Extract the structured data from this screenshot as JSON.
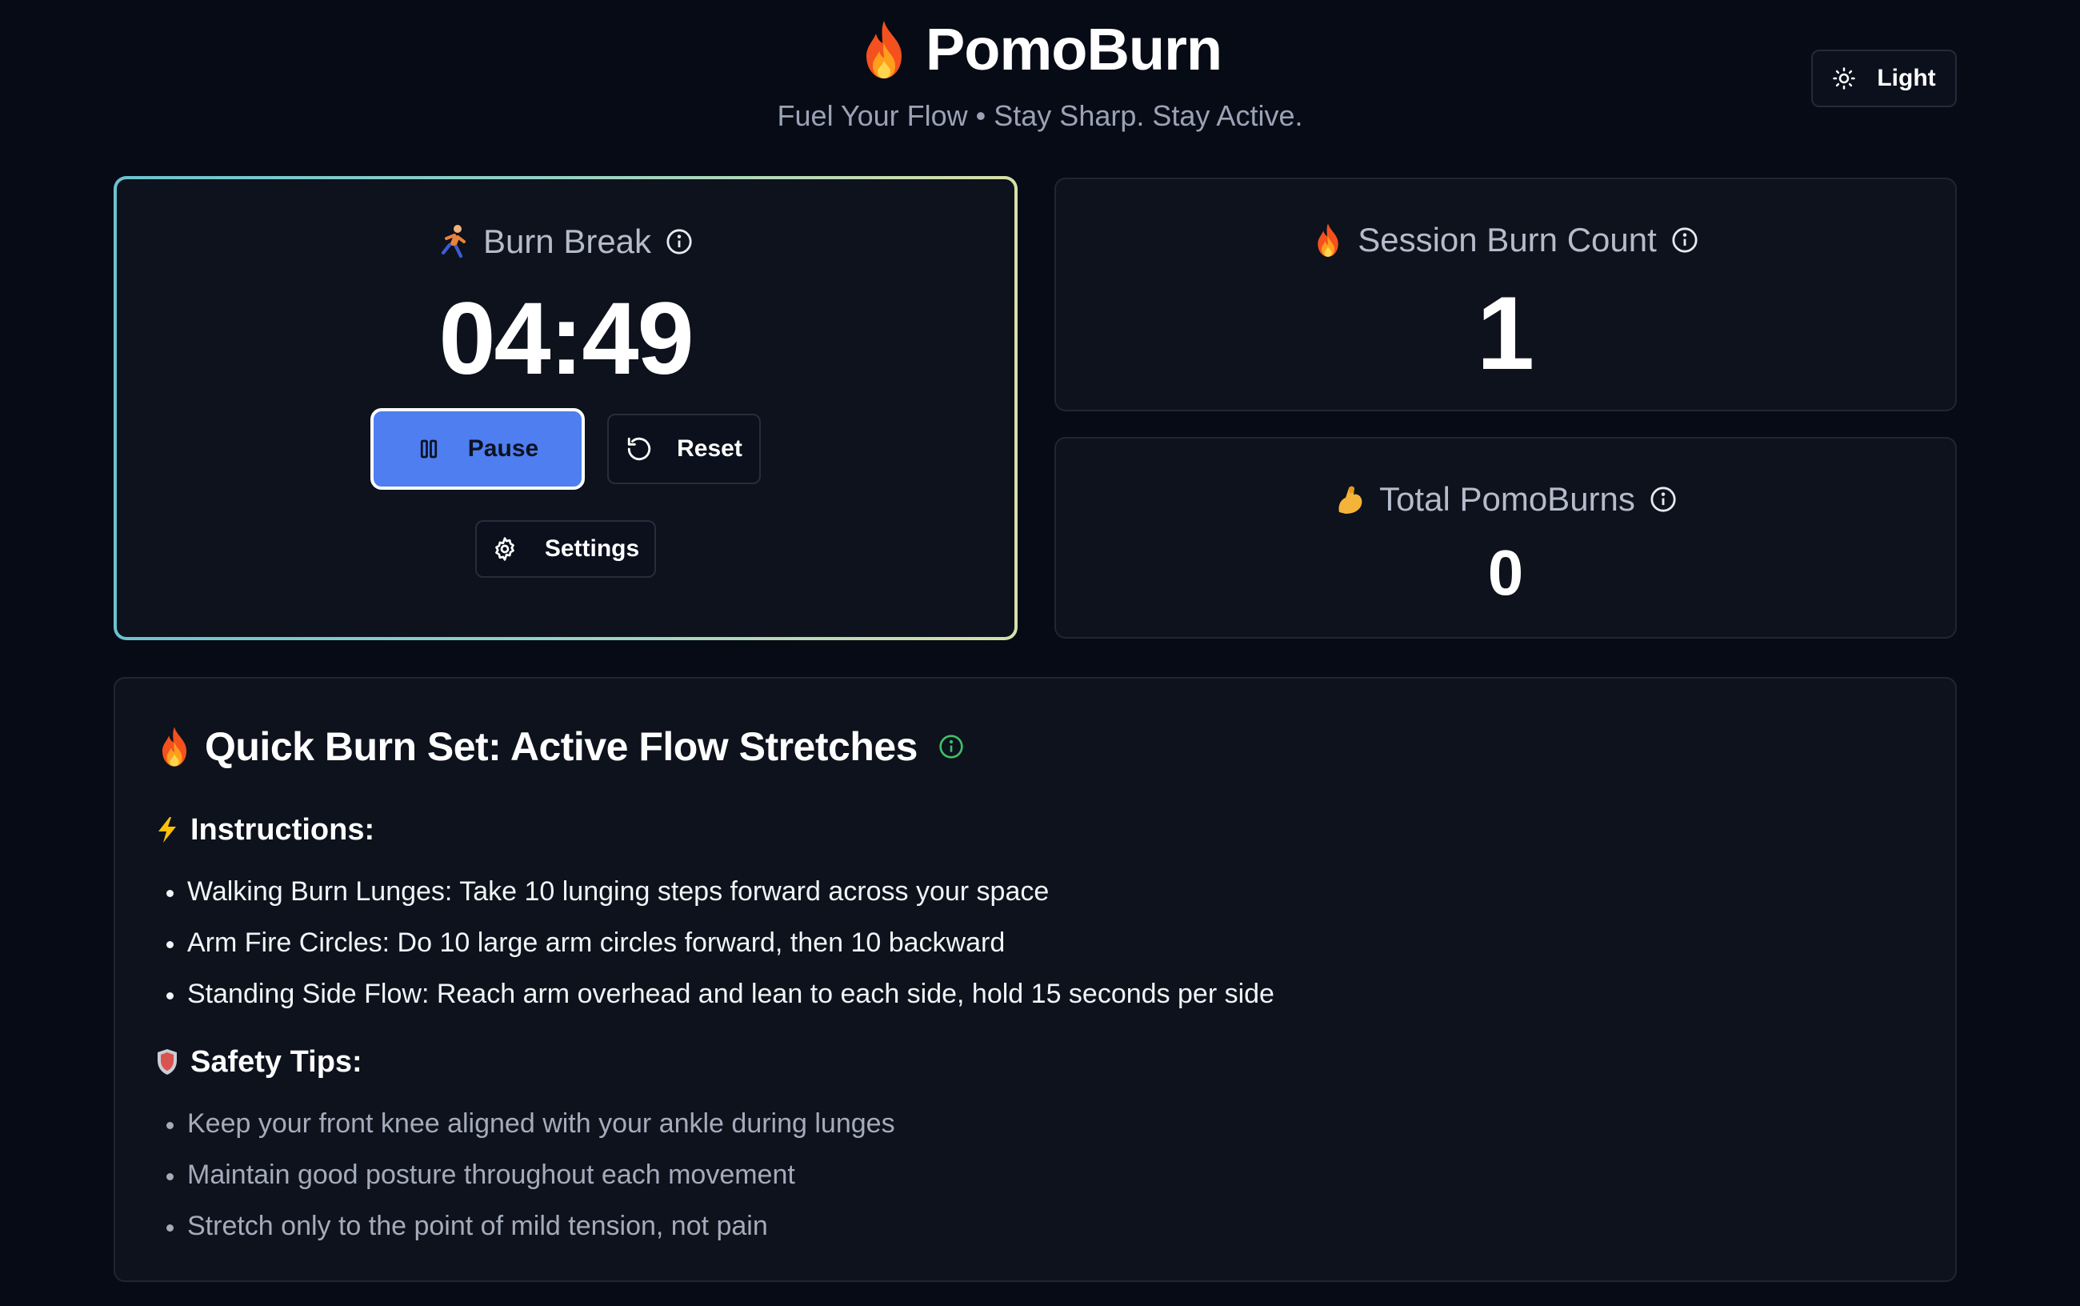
{
  "header": {
    "title": "PomoBurn",
    "title_icon": "fire-emoji",
    "tagline": "Fuel Your Flow • Stay Sharp. Stay Active.",
    "theme_toggle": {
      "label": "Light",
      "icon": "sun-icon"
    }
  },
  "timer": {
    "heading": "Burn Break",
    "heading_icon": "runner-emoji",
    "time": "04:49",
    "pause_label": "Pause",
    "reset_label": "Reset",
    "settings_label": "Settings"
  },
  "session": {
    "heading": "Session Burn Count",
    "heading_icon": "fire-emoji",
    "value": "1"
  },
  "total": {
    "heading": "Total PomoBurns",
    "heading_icon": "flexed-biceps-emoji",
    "value": "0"
  },
  "burn_set": {
    "title": "Quick Burn Set: Active Flow Stretches",
    "title_icon": "fire-emoji",
    "instructions_heading": "Instructions:",
    "instructions_icon": "lightning-emoji",
    "instructions": [
      "Walking Burn Lunges: Take 10 lunging steps forward across your space",
      "Arm Fire Circles: Do 10 large arm circles forward, then 10 backward",
      "Standing Side Flow: Reach arm overhead and lean to each side, hold 15 seconds per side"
    ],
    "safety_heading": "Safety Tips:",
    "safety_icon": "shield-emoji",
    "safety_tips": [
      "Keep your front knee aligned with your ankle during lunges",
      "Maintain good posture throughout each movement",
      "Stretch only to the point of mild tension, not pain"
    ]
  },
  "colors": {
    "background": "#070b16",
    "card": "#0d121c",
    "accent": "#4e7ef0",
    "info_green": "#3fbf6a"
  }
}
